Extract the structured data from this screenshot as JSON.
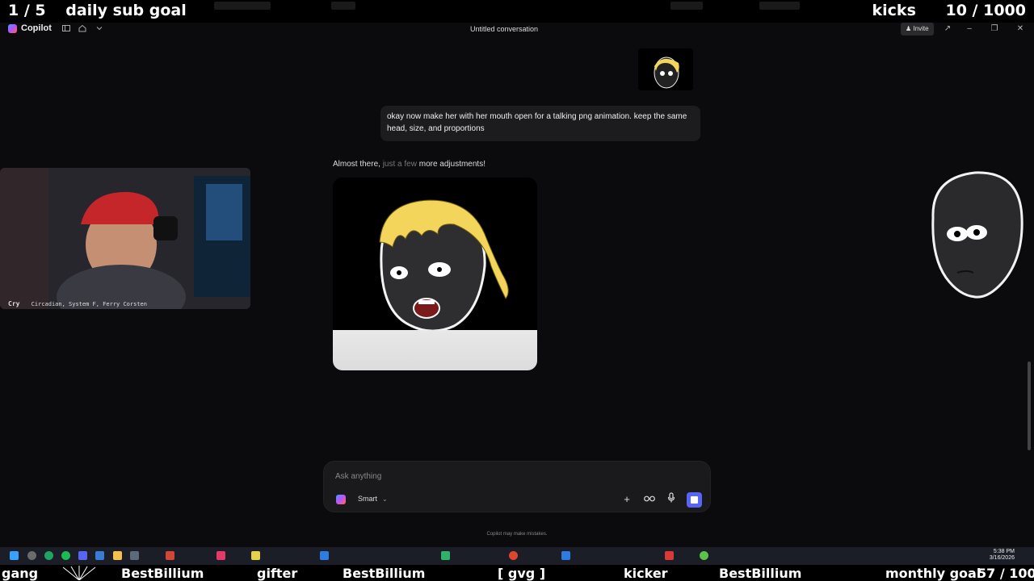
{
  "overlay": {
    "sub_progress": "1 / 5",
    "sub_label": "daily sub goal",
    "kicks_label": "kicks",
    "kicks_progress": "10 / 1000",
    "ticker": {
      "gang": "gang",
      "name1": "BestBillium",
      "gifter": "gifter",
      "name2": "BestBillium",
      "tag": "[ gvg ]",
      "kicker": "kicker",
      "name3": "BestBillium",
      "monthly_label": "monthly goal",
      "monthly_progress": "57 / 100"
    }
  },
  "titlebar": {
    "app_name": "Copilot",
    "conversation_title": "Untitled conversation",
    "invite_label": "Invite"
  },
  "chat": {
    "user_message": "okay now make her with her mouth open for a talking png animation. keep the same head, size, and proportions",
    "assistant_status_main": "Almost there, ",
    "assistant_status_fade": "just a few ",
    "assistant_status_end": "more adjustments!"
  },
  "webcam": {
    "signal": "Cry",
    "now_playing": "Circadian, System F, Ferry Corsten"
  },
  "composer": {
    "placeholder": "Ask anything",
    "mode": "Smart"
  },
  "disclaimer": "Copilot may make mistakes.",
  "taskbar": {
    "time": "5:38 PM",
    "date": "3/16/2026"
  },
  "colors": {
    "accent": "#5865f2",
    "app_bg": "#0b0b0d",
    "bubble_bg": "#1c1c1f"
  },
  "icons": [
    "copilot-logo-icon",
    "sidebar-icon",
    "home-icon",
    "chevron-down-icon",
    "invite-icon",
    "minimize-icon",
    "restore-icon",
    "close-icon",
    "plus-icon",
    "glasses-icon",
    "microphone-icon",
    "stop-icon"
  ]
}
